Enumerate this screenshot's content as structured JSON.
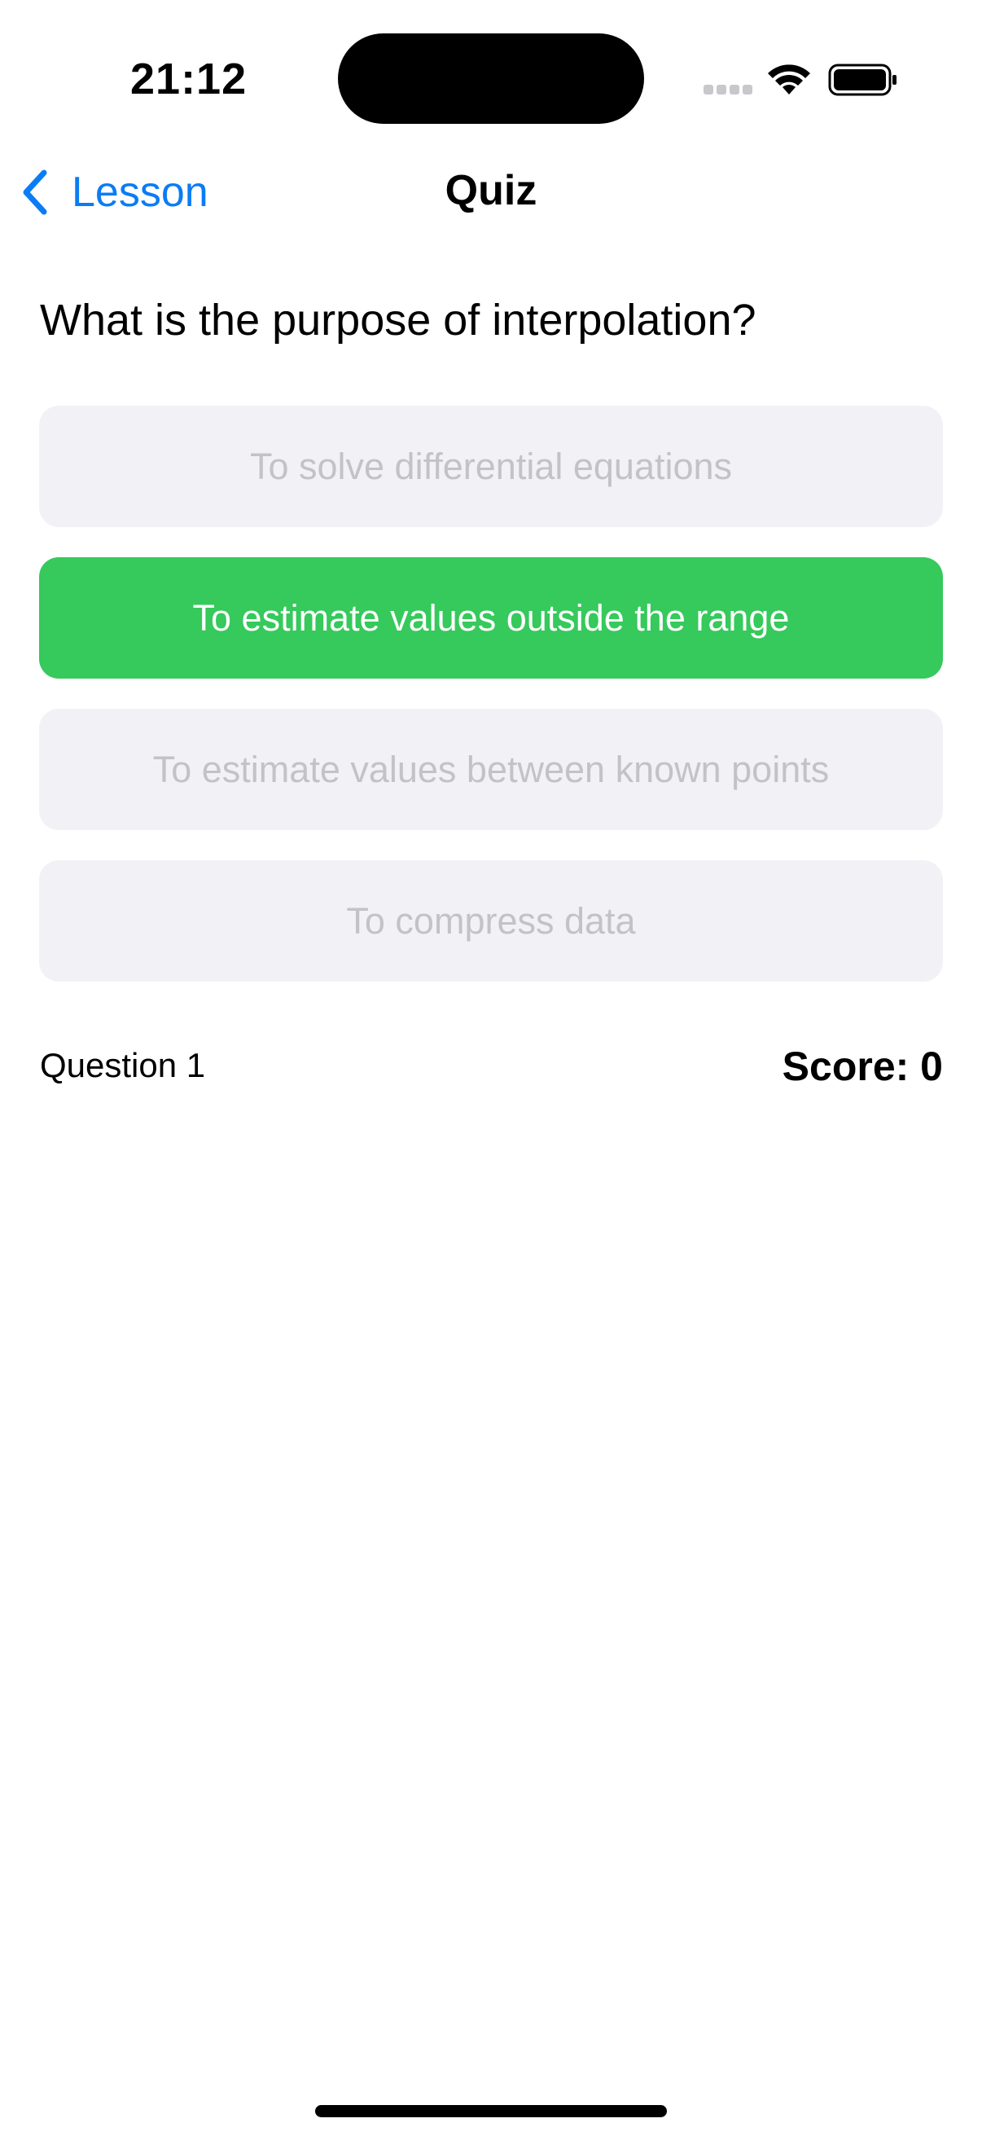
{
  "status_bar": {
    "time": "21:12"
  },
  "nav": {
    "back_label": "Lesson",
    "title": "Quiz"
  },
  "question": {
    "text": "What is the purpose of interpolation?"
  },
  "options": [
    {
      "label": "To solve differential equations",
      "selected": false
    },
    {
      "label": "To estimate values outside the range",
      "selected": true
    },
    {
      "label": "To estimate values between known points",
      "selected": false
    },
    {
      "label": "To compress data",
      "selected": false
    }
  ],
  "footer": {
    "question_label": "Question 1",
    "score_label": "Score: 0"
  },
  "colors": {
    "accent_blue": "#0a7cf5",
    "selected_green": "#36c95c",
    "option_background": "#f2f2f6",
    "option_text_disabled": "#c2c2c8"
  },
  "icons": {
    "back": "chevron-left-icon",
    "cellular": "cellular-signal-icon",
    "wifi": "wifi-icon",
    "battery": "battery-icon"
  }
}
